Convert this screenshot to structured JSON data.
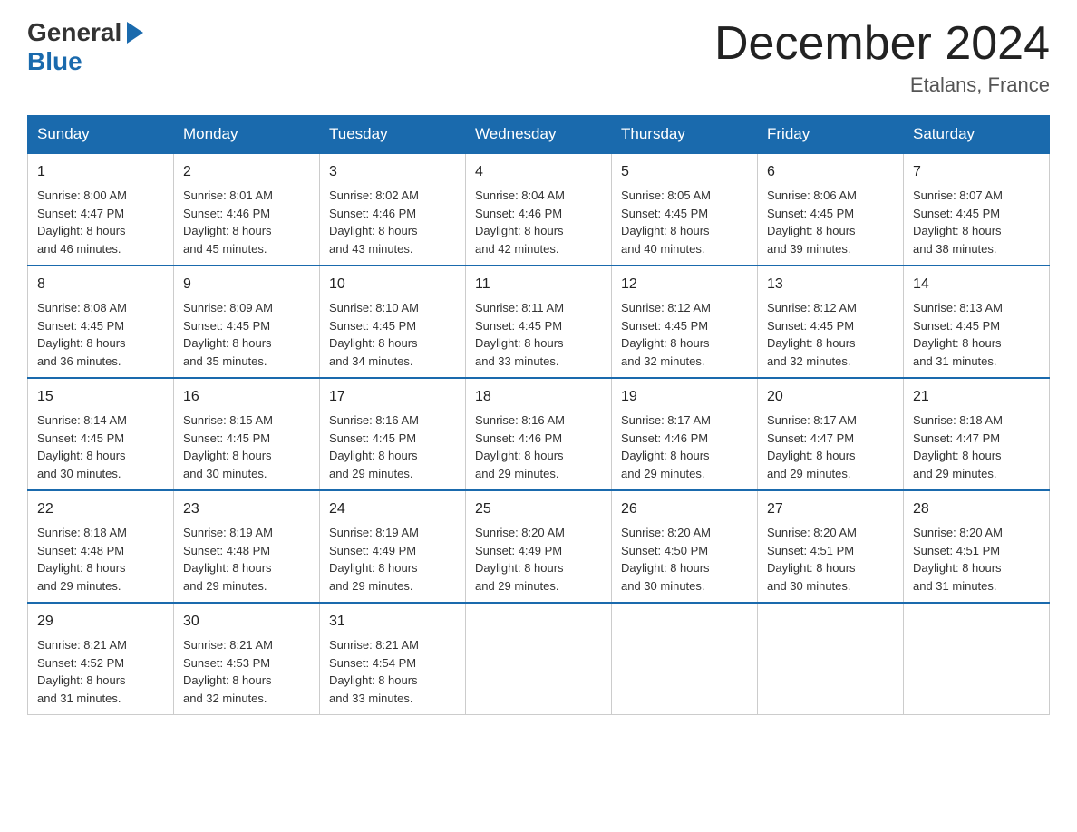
{
  "header": {
    "logo_general": "General",
    "logo_blue": "Blue",
    "month_title": "December 2024",
    "location": "Etalans, France"
  },
  "columns": [
    "Sunday",
    "Monday",
    "Tuesday",
    "Wednesday",
    "Thursday",
    "Friday",
    "Saturday"
  ],
  "weeks": [
    [
      {
        "day": "1",
        "sunrise": "Sunrise: 8:00 AM",
        "sunset": "Sunset: 4:47 PM",
        "daylight": "Daylight: 8 hours",
        "daylight2": "and 46 minutes."
      },
      {
        "day": "2",
        "sunrise": "Sunrise: 8:01 AM",
        "sunset": "Sunset: 4:46 PM",
        "daylight": "Daylight: 8 hours",
        "daylight2": "and 45 minutes."
      },
      {
        "day": "3",
        "sunrise": "Sunrise: 8:02 AM",
        "sunset": "Sunset: 4:46 PM",
        "daylight": "Daylight: 8 hours",
        "daylight2": "and 43 minutes."
      },
      {
        "day": "4",
        "sunrise": "Sunrise: 8:04 AM",
        "sunset": "Sunset: 4:46 PM",
        "daylight": "Daylight: 8 hours",
        "daylight2": "and 42 minutes."
      },
      {
        "day": "5",
        "sunrise": "Sunrise: 8:05 AM",
        "sunset": "Sunset: 4:45 PM",
        "daylight": "Daylight: 8 hours",
        "daylight2": "and 40 minutes."
      },
      {
        "day": "6",
        "sunrise": "Sunrise: 8:06 AM",
        "sunset": "Sunset: 4:45 PM",
        "daylight": "Daylight: 8 hours",
        "daylight2": "and 39 minutes."
      },
      {
        "day": "7",
        "sunrise": "Sunrise: 8:07 AM",
        "sunset": "Sunset: 4:45 PM",
        "daylight": "Daylight: 8 hours",
        "daylight2": "and 38 minutes."
      }
    ],
    [
      {
        "day": "8",
        "sunrise": "Sunrise: 8:08 AM",
        "sunset": "Sunset: 4:45 PM",
        "daylight": "Daylight: 8 hours",
        "daylight2": "and 36 minutes."
      },
      {
        "day": "9",
        "sunrise": "Sunrise: 8:09 AM",
        "sunset": "Sunset: 4:45 PM",
        "daylight": "Daylight: 8 hours",
        "daylight2": "and 35 minutes."
      },
      {
        "day": "10",
        "sunrise": "Sunrise: 8:10 AM",
        "sunset": "Sunset: 4:45 PM",
        "daylight": "Daylight: 8 hours",
        "daylight2": "and 34 minutes."
      },
      {
        "day": "11",
        "sunrise": "Sunrise: 8:11 AM",
        "sunset": "Sunset: 4:45 PM",
        "daylight": "Daylight: 8 hours",
        "daylight2": "and 33 minutes."
      },
      {
        "day": "12",
        "sunrise": "Sunrise: 8:12 AM",
        "sunset": "Sunset: 4:45 PM",
        "daylight": "Daylight: 8 hours",
        "daylight2": "and 32 minutes."
      },
      {
        "day": "13",
        "sunrise": "Sunrise: 8:12 AM",
        "sunset": "Sunset: 4:45 PM",
        "daylight": "Daylight: 8 hours",
        "daylight2": "and 32 minutes."
      },
      {
        "day": "14",
        "sunrise": "Sunrise: 8:13 AM",
        "sunset": "Sunset: 4:45 PM",
        "daylight": "Daylight: 8 hours",
        "daylight2": "and 31 minutes."
      }
    ],
    [
      {
        "day": "15",
        "sunrise": "Sunrise: 8:14 AM",
        "sunset": "Sunset: 4:45 PM",
        "daylight": "Daylight: 8 hours",
        "daylight2": "and 30 minutes."
      },
      {
        "day": "16",
        "sunrise": "Sunrise: 8:15 AM",
        "sunset": "Sunset: 4:45 PM",
        "daylight": "Daylight: 8 hours",
        "daylight2": "and 30 minutes."
      },
      {
        "day": "17",
        "sunrise": "Sunrise: 8:16 AM",
        "sunset": "Sunset: 4:45 PM",
        "daylight": "Daylight: 8 hours",
        "daylight2": "and 29 minutes."
      },
      {
        "day": "18",
        "sunrise": "Sunrise: 8:16 AM",
        "sunset": "Sunset: 4:46 PM",
        "daylight": "Daylight: 8 hours",
        "daylight2": "and 29 minutes."
      },
      {
        "day": "19",
        "sunrise": "Sunrise: 8:17 AM",
        "sunset": "Sunset: 4:46 PM",
        "daylight": "Daylight: 8 hours",
        "daylight2": "and 29 minutes."
      },
      {
        "day": "20",
        "sunrise": "Sunrise: 8:17 AM",
        "sunset": "Sunset: 4:47 PM",
        "daylight": "Daylight: 8 hours",
        "daylight2": "and 29 minutes."
      },
      {
        "day": "21",
        "sunrise": "Sunrise: 8:18 AM",
        "sunset": "Sunset: 4:47 PM",
        "daylight": "Daylight: 8 hours",
        "daylight2": "and 29 minutes."
      }
    ],
    [
      {
        "day": "22",
        "sunrise": "Sunrise: 8:18 AM",
        "sunset": "Sunset: 4:48 PM",
        "daylight": "Daylight: 8 hours",
        "daylight2": "and 29 minutes."
      },
      {
        "day": "23",
        "sunrise": "Sunrise: 8:19 AM",
        "sunset": "Sunset: 4:48 PM",
        "daylight": "Daylight: 8 hours",
        "daylight2": "and 29 minutes."
      },
      {
        "day": "24",
        "sunrise": "Sunrise: 8:19 AM",
        "sunset": "Sunset: 4:49 PM",
        "daylight": "Daylight: 8 hours",
        "daylight2": "and 29 minutes."
      },
      {
        "day": "25",
        "sunrise": "Sunrise: 8:20 AM",
        "sunset": "Sunset: 4:49 PM",
        "daylight": "Daylight: 8 hours",
        "daylight2": "and 29 minutes."
      },
      {
        "day": "26",
        "sunrise": "Sunrise: 8:20 AM",
        "sunset": "Sunset: 4:50 PM",
        "daylight": "Daylight: 8 hours",
        "daylight2": "and 30 minutes."
      },
      {
        "day": "27",
        "sunrise": "Sunrise: 8:20 AM",
        "sunset": "Sunset: 4:51 PM",
        "daylight": "Daylight: 8 hours",
        "daylight2": "and 30 minutes."
      },
      {
        "day": "28",
        "sunrise": "Sunrise: 8:20 AM",
        "sunset": "Sunset: 4:51 PM",
        "daylight": "Daylight: 8 hours",
        "daylight2": "and 31 minutes."
      }
    ],
    [
      {
        "day": "29",
        "sunrise": "Sunrise: 8:21 AM",
        "sunset": "Sunset: 4:52 PM",
        "daylight": "Daylight: 8 hours",
        "daylight2": "and 31 minutes."
      },
      {
        "day": "30",
        "sunrise": "Sunrise: 8:21 AM",
        "sunset": "Sunset: 4:53 PM",
        "daylight": "Daylight: 8 hours",
        "daylight2": "and 32 minutes."
      },
      {
        "day": "31",
        "sunrise": "Sunrise: 8:21 AM",
        "sunset": "Sunset: 4:54 PM",
        "daylight": "Daylight: 8 hours",
        "daylight2": "and 33 minutes."
      },
      null,
      null,
      null,
      null
    ]
  ]
}
